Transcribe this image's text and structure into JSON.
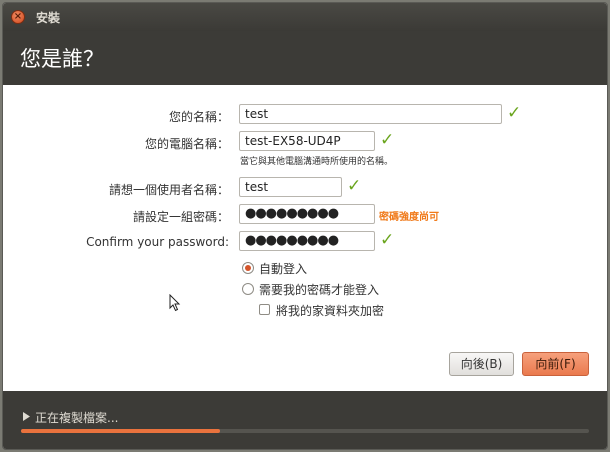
{
  "window": {
    "title": "安裝"
  },
  "page": {
    "title": "您是誰？"
  },
  "form": {
    "name_label": "您的名稱：",
    "name_value": "test",
    "computer_label": "您的電腦名稱：",
    "computer_value": "test-EX58-UD4P",
    "computer_hint": "當它與其他電腦溝通時所使用的名稱。",
    "username_label": "請想一個使用者名稱：",
    "username_value": "test",
    "password_label": "請設定一組密碼：",
    "password_value": "●●●●●●●●●",
    "password_strength": "密碼強度尚可",
    "confirm_label": "Confirm your password:",
    "confirm_value": "●●●●●●●●●"
  },
  "login": {
    "auto_login": "自動登入",
    "require_password": "需要我的密碼才能登入",
    "encrypt_home": "將我的家資料夾加密",
    "selected": "auto_login"
  },
  "buttons": {
    "back": "向後(B)",
    "forward": "向前(F)"
  },
  "footer": {
    "progress_text": "正在複製檔案...",
    "progress": 0.35
  },
  "colors": {
    "accent": "#e9723d",
    "check": "#6aa51e",
    "header_bg": "#3c3b37"
  },
  "icons": {
    "close": "close-icon",
    "check": "checkmark-icon",
    "expander": "triangle-right-icon",
    "cursor": "mouse-pointer-icon"
  }
}
